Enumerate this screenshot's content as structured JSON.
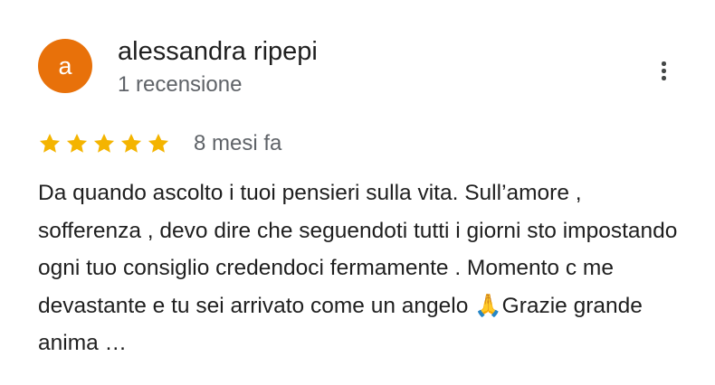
{
  "review": {
    "avatar_letter": "a",
    "avatar_color": "#e8710a",
    "author_name": "alessandra ripepi",
    "author_meta": "1 recensione",
    "rating": 5,
    "rating_max": 5,
    "star_color": "#f4b400",
    "date": "8 mesi fa",
    "text": "Da quando ascolto i tuoi pensieri sulla vita. Sull’amore , sofferenza , devo dire che seguendoti tutti i giorni sto impostando ogni tuo consiglio credendoci fermamente . Momento c me devastante e tu sei arrivato come un angelo 🙏Grazie grande anima …",
    "more_icon": "more-vert-icon",
    "star_icon": "star-icon"
  }
}
